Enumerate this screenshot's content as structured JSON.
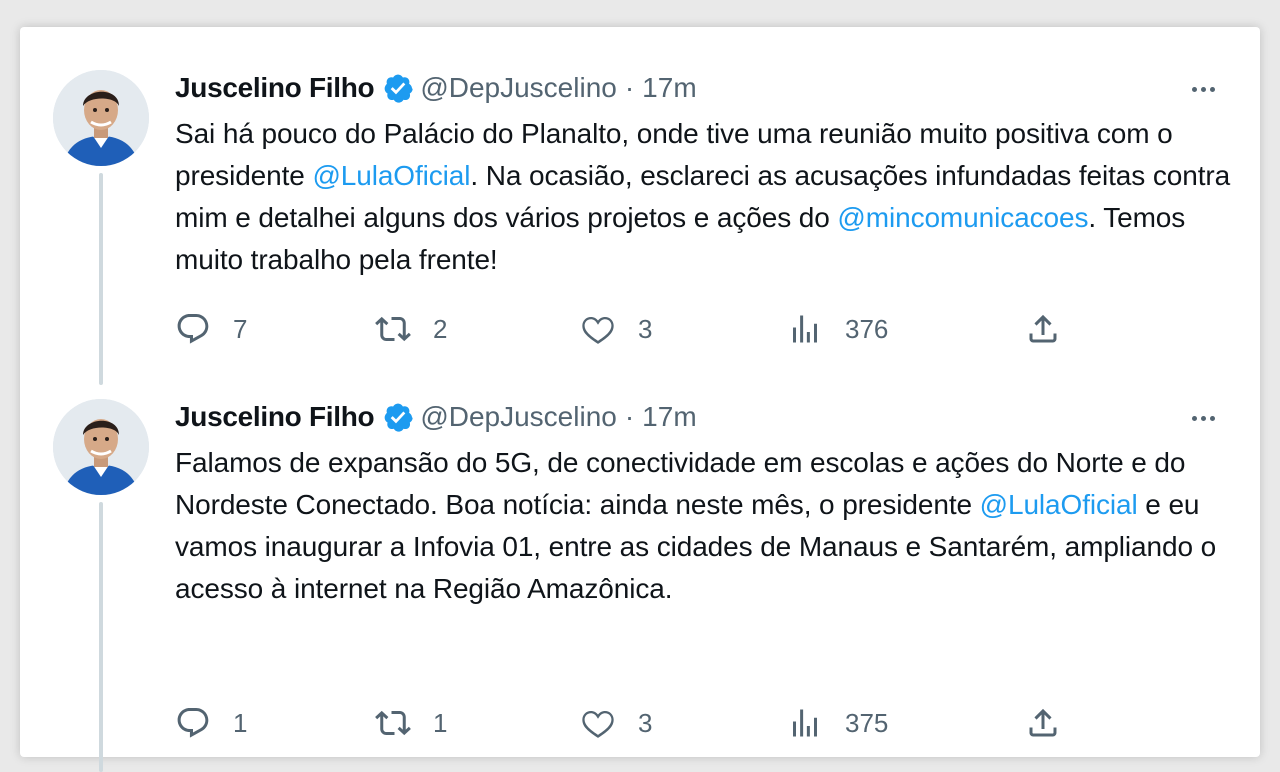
{
  "tweets": [
    {
      "author": {
        "name": "Juscelino Filho",
        "handle": "@DepJuscelino",
        "separator": "·",
        "time": "17m"
      },
      "text_parts": [
        "Sai há pouco do Palácio do Planalto, onde tive uma reunião muito positiva com o presidente ",
        "@LulaOficial",
        ". Na ocasião, esclareci as acusações infundadas feitas contra mim e detalhei alguns dos vários projetos e ações do ",
        "@mincomunicacoes",
        ". Temos muito trabalho pela frente!"
      ],
      "stats": {
        "replies": "7",
        "retweets": "2",
        "likes": "3",
        "views": "376"
      }
    },
    {
      "author": {
        "name": "Juscelino Filho",
        "handle": "@DepJuscelino",
        "separator": "·",
        "time": "17m"
      },
      "text_parts": [
        "Falamos de expansão do 5G, de conectividade em escolas e ações do Norte e do Nordeste Conectado. Boa notícia: ainda neste mês, o presidente ",
        "@LulaOficial",
        " e eu vamos inaugurar a Infovia 01, entre as cidades de Manaus e Santarém, ampliando o acesso à internet na Região Amazônica."
      ],
      "stats": {
        "replies": "1",
        "retweets": "1",
        "likes": "3",
        "views": "375"
      }
    }
  ],
  "icons": {
    "verified": "verified-badge-icon",
    "more": "more-options-icon",
    "reply": "reply-icon",
    "retweet": "retweet-icon",
    "like": "heart-icon",
    "views": "views-icon",
    "share": "share-icon"
  },
  "colors": {
    "mention": "#1d9bf0",
    "verified": "#1d9bf0",
    "secondary_text": "#536471",
    "primary_text": "#0f1419",
    "thread_line": "#cfd9de"
  }
}
